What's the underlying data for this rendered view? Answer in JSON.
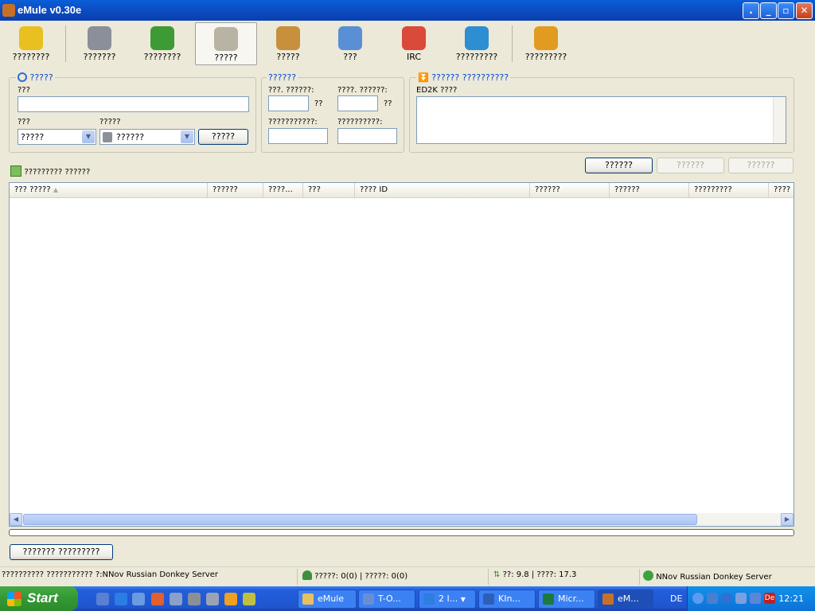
{
  "window": {
    "title": "eMule v0.30e"
  },
  "toolbar": {
    "items": [
      {
        "label": "????????",
        "icon": "connect-icon",
        "color": "#e8c020"
      },
      {
        "label": "???????",
        "icon": "servers-icon",
        "color": "#8a8f99"
      },
      {
        "label": "????????",
        "icon": "transfers-icon",
        "color": "#3e9a35"
      },
      {
        "label": "?????",
        "icon": "search-icon",
        "color": "#b9b3a4"
      },
      {
        "label": "?????",
        "icon": "shared-files-icon",
        "color": "#c8903c"
      },
      {
        "label": "???",
        "icon": "messages-icon",
        "color": "#5a8fd6"
      },
      {
        "label": "IRC",
        "icon": "irc-icon",
        "color": "#d94a3a"
      },
      {
        "label": "?????????",
        "icon": "statistics-icon",
        "color": "#2d8fd1"
      },
      {
        "label": "?????????",
        "icon": "preferences-icon",
        "color": "#e09b20"
      }
    ]
  },
  "search_group": {
    "title": "?????",
    "name_label": "???",
    "type_label": "???",
    "type_value": "?????",
    "method_label": "?????",
    "method_value": "??????",
    "start_label": "?????"
  },
  "filter_group": {
    "title": "??????",
    "min_size_label": "???. ??????:",
    "max_size_label": "????. ??????:",
    "unit": "??",
    "availability_label": "???????????:",
    "extension_label": "??????????:"
  },
  "ed2k_group": {
    "title": "?????? ??????????",
    "link_label": "ED2K ????"
  },
  "action_buttons": {
    "download": "??????",
    "close": "??????",
    "close_all": "??????"
  },
  "results": {
    "label": "????????? ??????",
    "columns": [
      "??? ?????",
      "??????",
      "????...",
      "???",
      "???? ID",
      "??????",
      "??????",
      "?????????",
      "????"
    ]
  },
  "bottom": {
    "reset_button": "??????? ?????????"
  },
  "statusbar": {
    "message": "?????????? ??????????? ?:NNov Russian Donkey Server",
    "users": "?????: 0(0) | ?????: 0(0)",
    "speed": "??: 9.8 | ????: 17.3",
    "server": "NNov Russian Donkey Server"
  },
  "taskbar": {
    "start": "Start",
    "tasks": [
      {
        "label": "eMule",
        "color": "#e8c060"
      },
      {
        "label": "T-O...",
        "color": "#6a8ed6"
      },
      {
        "label": "2 I...",
        "color": "#2e7de0"
      },
      {
        "label": "KIn...",
        "color": "#2d5fb9"
      },
      {
        "label": "Micr...",
        "color": "#1d7a3d"
      },
      {
        "label": "eM...",
        "color": "#c8702a"
      }
    ],
    "lang": "DE",
    "tray_lang": "De",
    "clock": "12:21"
  }
}
